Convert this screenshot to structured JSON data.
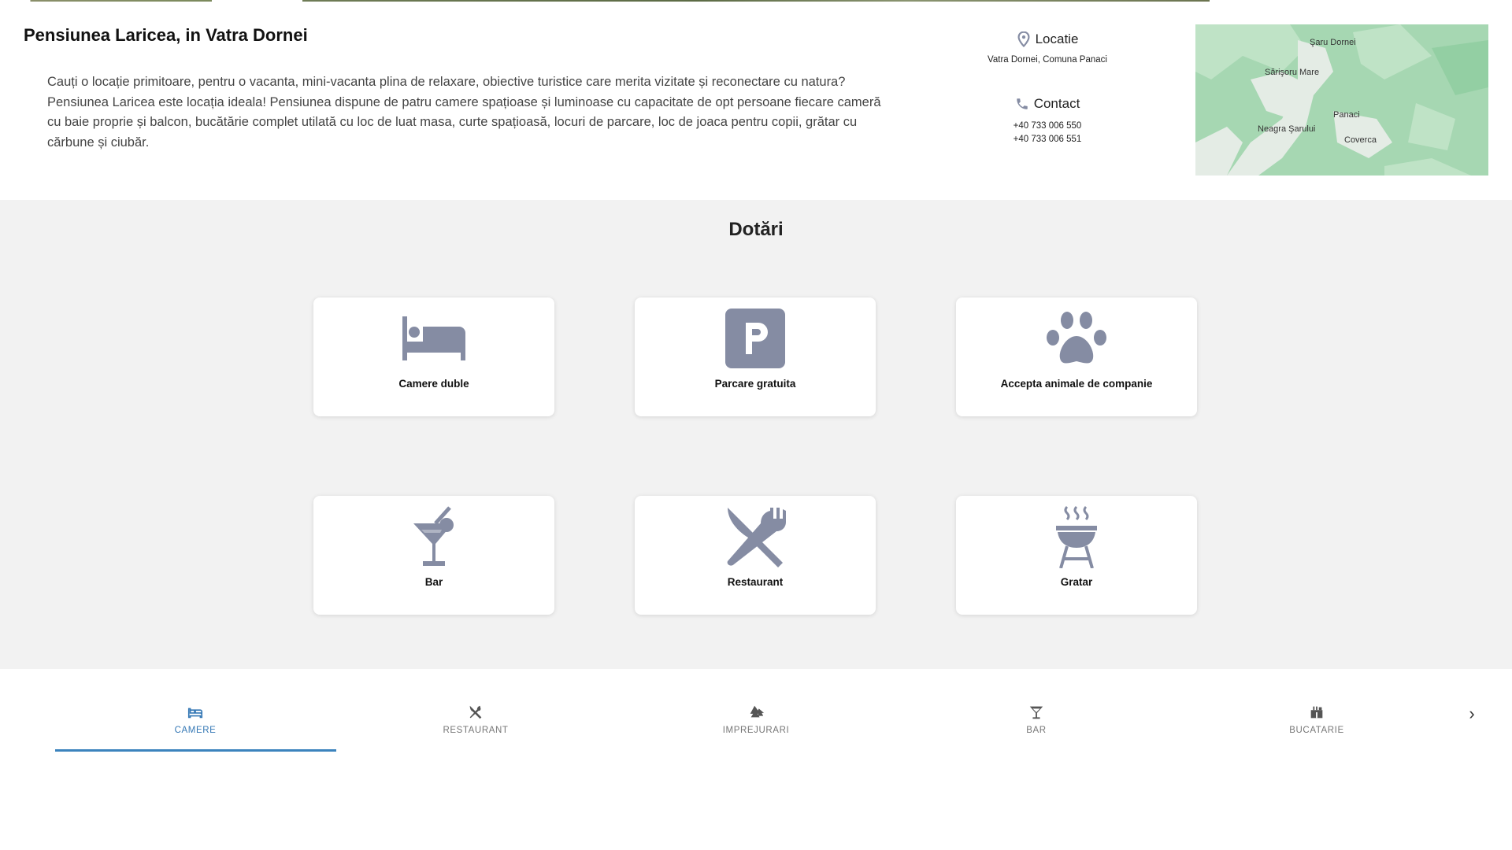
{
  "header": {
    "title": "Pensiunea Laricea, in Vatra Dornei",
    "description": "Cauți o locație primitoare, pentru o vacanta, mini-vacanta plina de relaxare, obiective turistice care merita vizitate și reconectare cu natura? Pensiunea Laricea este locația ideala! Pensiunea dispune de patru camere spațioase și luminoase cu capacitate de opt persoane fiecare cameră cu baie proprie și balcon, bucătărie complet utilată cu loc de luat masa, curte spațioasă, locuri de parcare, loc de joaca pentru copii, grătar cu cărbune și ciubăr."
  },
  "location": {
    "label": "Locatie",
    "value": "Vatra Dornei, Comuna Panaci"
  },
  "contact": {
    "label": "Contact",
    "phones": [
      "+40 733 006 550",
      "+40 733 006 551"
    ]
  },
  "map": {
    "places": [
      "Şaru Dornei",
      "Sărişoru Mare",
      "Panaci",
      "Neagra Şarului",
      "Coverca"
    ]
  },
  "dotari": {
    "title": "Dotări",
    "items": [
      {
        "label": "Camere duble",
        "icon": "bed-icon"
      },
      {
        "label": "Parcare gratuita",
        "icon": "parking-icon"
      },
      {
        "label": "Accepta animale de companie",
        "icon": "paw-icon"
      },
      {
        "label": "Bar",
        "icon": "cocktail-icon"
      },
      {
        "label": "Restaurant",
        "icon": "utensils-icon"
      },
      {
        "label": "Gratar",
        "icon": "grill-icon"
      }
    ]
  },
  "tabs": {
    "items": [
      {
        "label": "CAMERE",
        "icon": "bed-icon",
        "active": true
      },
      {
        "label": "RESTAURANT",
        "icon": "utensils-icon",
        "active": false
      },
      {
        "label": "IMPREJURARI",
        "icon": "trees-icon",
        "active": false
      },
      {
        "label": "BAR",
        "icon": "cocktail-icon",
        "active": false
      },
      {
        "label": "BUCATARIE",
        "icon": "kitchen-icon",
        "active": false
      }
    ],
    "next_label": "›"
  },
  "colors": {
    "icon_gray": "#858ca3",
    "accent_blue": "#3b83bd",
    "map_green": "#a6d7b2"
  }
}
